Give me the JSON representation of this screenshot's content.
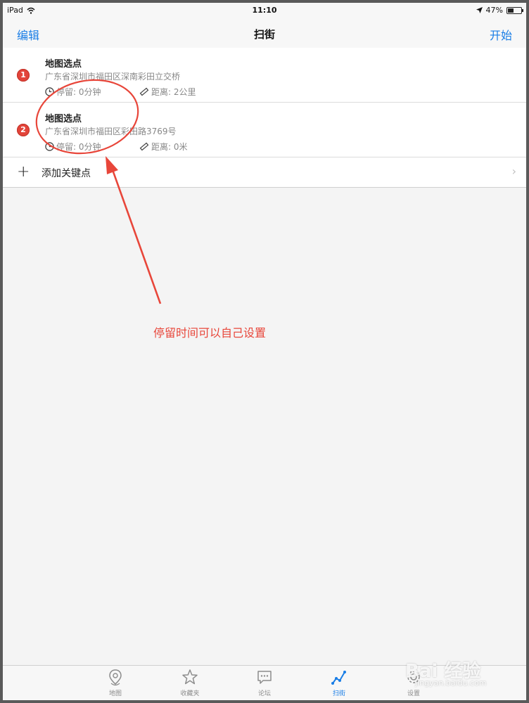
{
  "status": {
    "device": "iPad",
    "time": "11:10",
    "battery": "47%",
    "battery_level": 0.47
  },
  "nav": {
    "left_label": "编辑",
    "title": "扫街",
    "right_label": "开始"
  },
  "waypoints": [
    {
      "index": "1",
      "title": "地图选点",
      "address": "广东省深圳市福田区深南彩田立交桥",
      "stay": "停留: 0分钟",
      "distance": "距离: 2公里"
    },
    {
      "index": "2",
      "title": "地图选点",
      "address": "广东省深圳市福田区彩田路3769号",
      "stay": "停留: 0分钟",
      "distance": "距离: 0米"
    }
  ],
  "add_row": {
    "label": "添加关键点"
  },
  "annotation": {
    "text": "停留时间可以自己设置",
    "color": "#e8463a"
  },
  "tabs": [
    {
      "label": "地图",
      "icon": "map-pin-icon"
    },
    {
      "label": "收藏夹",
      "icon": "star-icon"
    },
    {
      "label": "论坛",
      "icon": "chat-icon"
    },
    {
      "label": "扫街",
      "icon": "route-icon",
      "active": true
    },
    {
      "label": "设置",
      "icon": "gear-icon"
    }
  ],
  "watermark": {
    "logo": "Bai 经验",
    "url": "jingyan.baidu.com"
  },
  "colors": {
    "accent": "#1a7ee6",
    "badge": "#e2443a"
  }
}
